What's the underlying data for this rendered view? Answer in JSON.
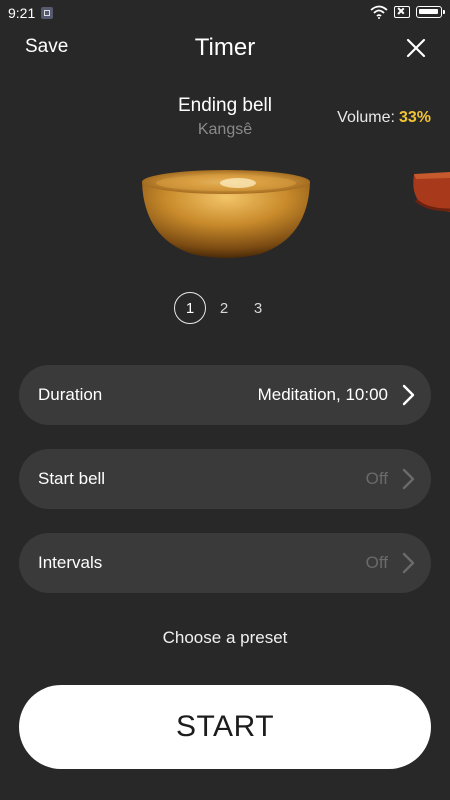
{
  "status_bar": {
    "time": "9:21",
    "icons": [
      "notification-icon",
      "wifi-icon",
      "sim-off-icon",
      "battery-icon"
    ]
  },
  "header": {
    "save_label": "Save",
    "title": "Timer",
    "close_icon": "close-icon"
  },
  "bell": {
    "name": "Ending bell",
    "subtitle": "Kangsê",
    "volume_label": "Volume:",
    "volume_value": "33%",
    "volume_color": "#f2c335",
    "pages": [
      "1",
      "2",
      "3"
    ],
    "selected_page": "1"
  },
  "settings": {
    "duration": {
      "label": "Duration",
      "value": "Meditation, 10:00"
    },
    "start_bell": {
      "label": "Start bell",
      "value": "Off"
    },
    "intervals": {
      "label": "Intervals",
      "value": "Off"
    }
  },
  "preset_label": "Choose a preset",
  "start_label": "START",
  "colors": {
    "background": "#282828",
    "row_background": "#3a3a3a",
    "accent": "#f2c335"
  }
}
